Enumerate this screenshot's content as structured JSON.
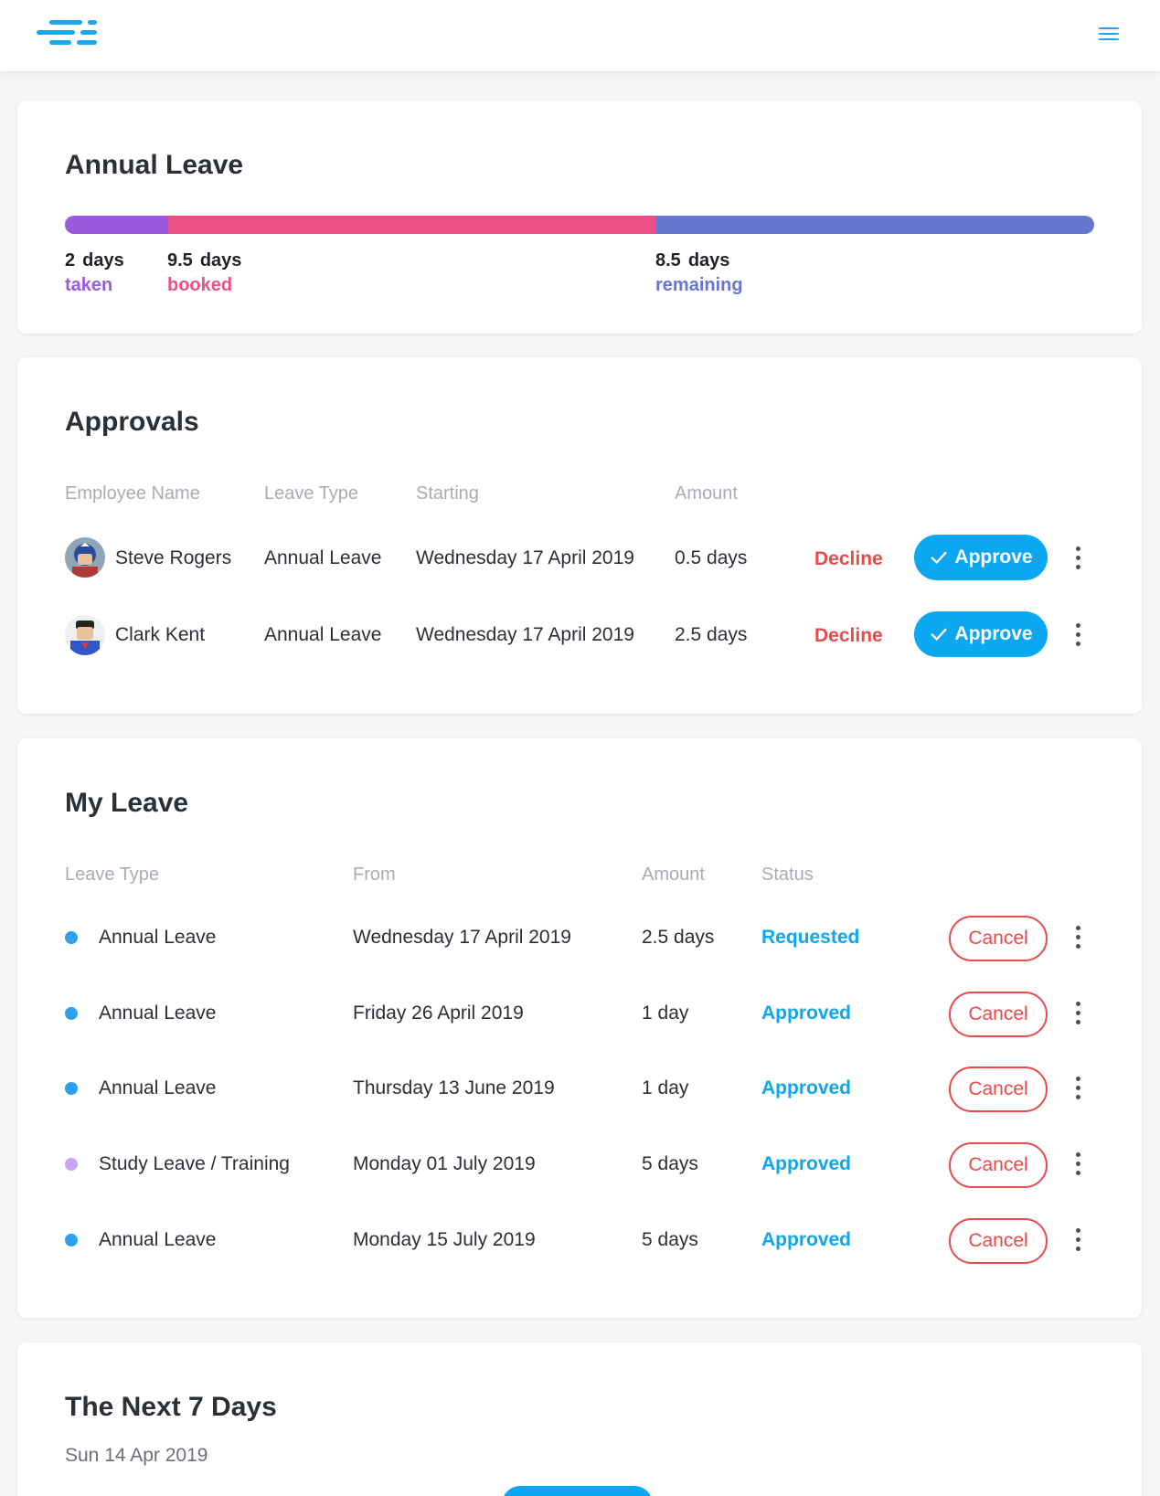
{
  "colors": {
    "accent": "#0ba7f0",
    "taken": "#9b59e0",
    "booked": "#ec4f86",
    "remaining": "#6776d0",
    "danger": "#e94a4a",
    "dot_annual": "#2f9ff0",
    "dot_study": "#c6a6ee"
  },
  "header": {
    "logo_icon": "logo-icon",
    "menu_icon": "hamburger-menu-icon"
  },
  "annual_leave": {
    "title": "Annual Leave",
    "taken": {
      "value": "2",
      "unit": "days",
      "label": "taken"
    },
    "booked": {
      "value": "9.5",
      "unit": "days",
      "label": "booked"
    },
    "remaining": {
      "value": "8.5",
      "unit": "days",
      "label": "remaining"
    },
    "bar_fractions": {
      "taken": 0.1,
      "booked": 0.475,
      "remaining": 0.425
    }
  },
  "approvals": {
    "title": "Approvals",
    "columns": [
      "Employee Name",
      "Leave Type",
      "Starting",
      "Amount"
    ],
    "rows": [
      {
        "name": "Steve Rogers",
        "type": "Annual Leave",
        "starting": "Wednesday 17 April 2019",
        "amount": "0.5 days",
        "decline": "Decline",
        "approve": "Approve"
      },
      {
        "name": "Clark Kent",
        "type": "Annual Leave",
        "starting": "Wednesday 17 April 2019",
        "amount": "2.5 days",
        "decline": "Decline",
        "approve": "Approve"
      }
    ]
  },
  "my_leave": {
    "title": "My Leave",
    "columns": [
      "Leave Type",
      "From",
      "Amount",
      "Status"
    ],
    "rows": [
      {
        "type": "Annual Leave",
        "from": "Wednesday 17 April 2019",
        "amount": "2.5 days",
        "status": "Requested",
        "cancel": "Cancel"
      },
      {
        "type": "Annual Leave",
        "from": "Friday 26 April 2019",
        "amount": "1 day",
        "status": "Approved",
        "cancel": "Cancel"
      },
      {
        "type": "Annual Leave",
        "from": "Thursday 13 June 2019",
        "amount": "1 day",
        "status": "Approved",
        "cancel": "Cancel"
      },
      {
        "type": "Study Leave / Training",
        "from": "Monday 01 July 2019",
        "amount": "5 days",
        "status": "Approved",
        "cancel": "Cancel"
      },
      {
        "type": "Annual Leave",
        "from": "Monday 15 July 2019",
        "amount": "5 days",
        "status": "Approved",
        "cancel": "Cancel"
      }
    ]
  },
  "next_days": {
    "title": "The Next 7 Days",
    "date": "Sun 14 Apr 2019"
  }
}
